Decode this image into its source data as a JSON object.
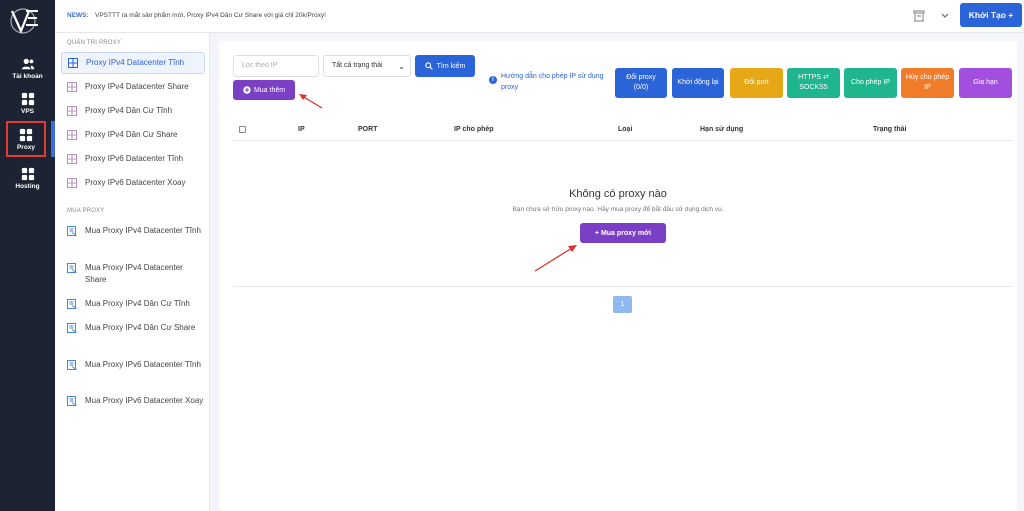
{
  "news": {
    "label": "NEWS:",
    "text": "VPSTTT ra mắt sản phẩm mới, Proxy IPv4 Dân Cư Share với giá chỉ 20k/Proxy!"
  },
  "header": {
    "create_label": "Khởi Tạo +"
  },
  "rail": [
    {
      "label": "Tài khoản",
      "icon": "users-icon"
    },
    {
      "label": "VPS",
      "icon": "grid-icon"
    },
    {
      "label": "Proxy",
      "icon": "grid-icon",
      "active": true
    },
    {
      "label": "Hosting",
      "icon": "grid-icon"
    }
  ],
  "sidebar": {
    "manage_title": "QUẢN TRỊ PROXY",
    "manage_items": [
      "Proxy IPv4 Datacenter Tĩnh",
      "Proxy IPv4 Datacenter Share",
      "Proxy IPv4 Dân Cư Tĩnh",
      "Proxy IPv4 Dân Cư Share",
      "Proxy IPv6 Datacenter Tĩnh",
      "Proxy IPv6 Datacenter Xoay"
    ],
    "buy_title": "MUA PROXY",
    "buy_items": [
      "Mua Proxy IPv4 Datacenter Tĩnh",
      "Mua Proxy IPv4 Datacenter Share",
      "Mua Proxy IPv4 Dân Cư Tĩnh",
      "Mua Proxy IPv4 Dân Cư Share",
      "Mua Proxy IPv6 Datacenter Tĩnh",
      "Mua Proxy IPv6 Datacenter Xoay"
    ]
  },
  "filters": {
    "ip_placeholder": "Lọc theo IP",
    "status_selected": "Tất cả trạng thái",
    "search_label": "Tìm kiếm",
    "buy_more_label": "Mua thêm"
  },
  "guide": {
    "text": "Hướng dẫn cho phép IP sử dụng proxy"
  },
  "actions": [
    {
      "label": "Đổi proxy (0/0)",
      "color": "#2b63d9"
    },
    {
      "label": "Khởi động lại",
      "color": "#2b63d9"
    },
    {
      "label": "Đổi port",
      "color": "#e6a817"
    },
    {
      "label": "HTTPS ⇄ SOCKS5",
      "color": "#1fb58f"
    },
    {
      "label": "Cho phép IP",
      "color": "#1fb58f"
    },
    {
      "label": "Hủy cho phép IP",
      "color": "#f07c2a"
    },
    {
      "label": "Gia hạn",
      "color": "#a24fe0"
    }
  ],
  "table": {
    "columns": [
      "IP",
      "PORT",
      "IP cho phép",
      "Loại",
      "Hạn sử dụng",
      "Trạng thái"
    ]
  },
  "empty": {
    "title": "Không có proxy nào",
    "subtitle": "Bạn chưa sở hữu proxy nào. Hãy mua proxy để bắt đầu sử dụng dịch vụ.",
    "button": "+ Mua proxy mới"
  },
  "pagination": {
    "current": "1"
  }
}
